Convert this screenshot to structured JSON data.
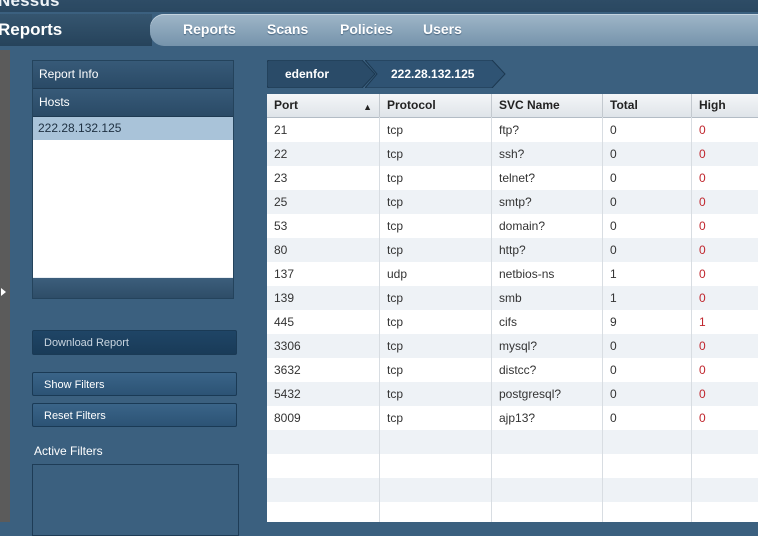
{
  "app": {
    "name": "Nessus",
    "section_title": "Reports"
  },
  "nav": {
    "tabs": [
      {
        "label": "Reports"
      },
      {
        "label": "Scans"
      },
      {
        "label": "Policies"
      },
      {
        "label": "Users"
      }
    ]
  },
  "sidebar": {
    "report_info_label": "Report Info",
    "hosts_label": "Hosts",
    "hosts": [
      "222.28.132.125"
    ],
    "download_label": "Download Report",
    "show_filters_label": "Show Filters",
    "reset_filters_label": "Reset Filters",
    "active_filters_label": "Active Filters"
  },
  "breadcrumb": [
    "edenfor",
    "222.28.132.125"
  ],
  "table": {
    "columns": [
      "Port",
      "Protocol",
      "SVC Name",
      "Total",
      "High"
    ],
    "sort": {
      "column": "Port",
      "direction": "ascending",
      "indicator": "▲"
    },
    "rows": [
      [
        "21",
        "tcp",
        "ftp?",
        "0",
        "0"
      ],
      [
        "22",
        "tcp",
        "ssh?",
        "0",
        "0"
      ],
      [
        "23",
        "tcp",
        "telnet?",
        "0",
        "0"
      ],
      [
        "25",
        "tcp",
        "smtp?",
        "0",
        "0"
      ],
      [
        "53",
        "tcp",
        "domain?",
        "0",
        "0"
      ],
      [
        "80",
        "tcp",
        "http?",
        "0",
        "0"
      ],
      [
        "137",
        "udp",
        "netbios-ns",
        "1",
        "0"
      ],
      [
        "139",
        "tcp",
        "smb",
        "1",
        "0"
      ],
      [
        "445",
        "tcp",
        "cifs",
        "9",
        "1"
      ],
      [
        "3306",
        "tcp",
        "mysql?",
        "0",
        "0"
      ],
      [
        "3632",
        "tcp",
        "distcc?",
        "0",
        "0"
      ],
      [
        "5432",
        "tcp",
        "postgresql?",
        "0",
        "0"
      ],
      [
        "8009",
        "tcp",
        "ajp13?",
        "0",
        "0"
      ]
    ]
  },
  "colors": {
    "background": "#3b607f",
    "row_alt": "#eef2f6",
    "host_selected": "#a9c3d9",
    "high_severity": "#c0262d"
  }
}
